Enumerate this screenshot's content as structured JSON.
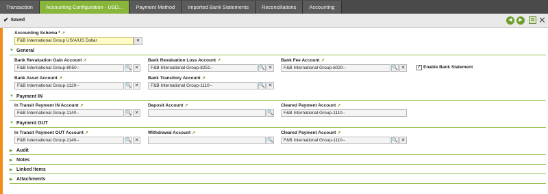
{
  "tabs": [
    {
      "label": "Transaction"
    },
    {
      "label": "Accounting Configuration - USD..."
    },
    {
      "label": "Payment Method"
    },
    {
      "label": "Imported Bank Statements"
    },
    {
      "label": "Reconciliations"
    },
    {
      "label": "Accounting"
    }
  ],
  "toolbar": {
    "status": "Saved"
  },
  "schema": {
    "label": "Accounting Schema *",
    "value": "F&B International Group US/A/US Dollar"
  },
  "sections": {
    "general": "General",
    "payment_in": "Payment IN",
    "payment_out": "Payment OUT",
    "audit": "Audit",
    "notes": "Notes",
    "linked_items": "Linked Items",
    "attachments": "Attachments"
  },
  "general": {
    "gain": {
      "label": "Bank Revaluation Gain Account",
      "value": "F&B International Group-8050--"
    },
    "loss": {
      "label": "Bank Revaluation Loss Account",
      "value": "F&B International Group-8251--"
    },
    "fee": {
      "label": "Bank Fee Account",
      "value": "F&B International Group-6020--"
    },
    "enable_statement": {
      "label": "Enable Bank Statement",
      "checked": true
    },
    "asset": {
      "label": "Bank Asset Account",
      "value": "F&B International Group-1120--"
    },
    "transitory": {
      "label": "Bank Transitory Account",
      "value": "F&B International Group-1110--"
    }
  },
  "payment_in": {
    "transit": {
      "label": "In Transit Payment IN Account",
      "value": "F&B International Group-1140--"
    },
    "deposit": {
      "label": "Deposit Account",
      "value": ""
    },
    "cleared": {
      "label": "Cleared Payment Account",
      "value": "F&B International Group-1110--"
    }
  },
  "payment_out": {
    "transit": {
      "label": "In Transit Payment OUT Account",
      "value": "F&B International Group-1140--"
    },
    "withdrawal": {
      "label": "Withdrawal Account",
      "value": ""
    },
    "cleared": {
      "label": "Cleared Payment Account",
      "value": "F&B International Group-1110--"
    }
  },
  "icons": {
    "link": "link-arrow-icon",
    "search": "search-icon",
    "clear": "clear-x-icon",
    "expand": "triangle-down-icon",
    "collapse": "triangle-right-icon"
  }
}
